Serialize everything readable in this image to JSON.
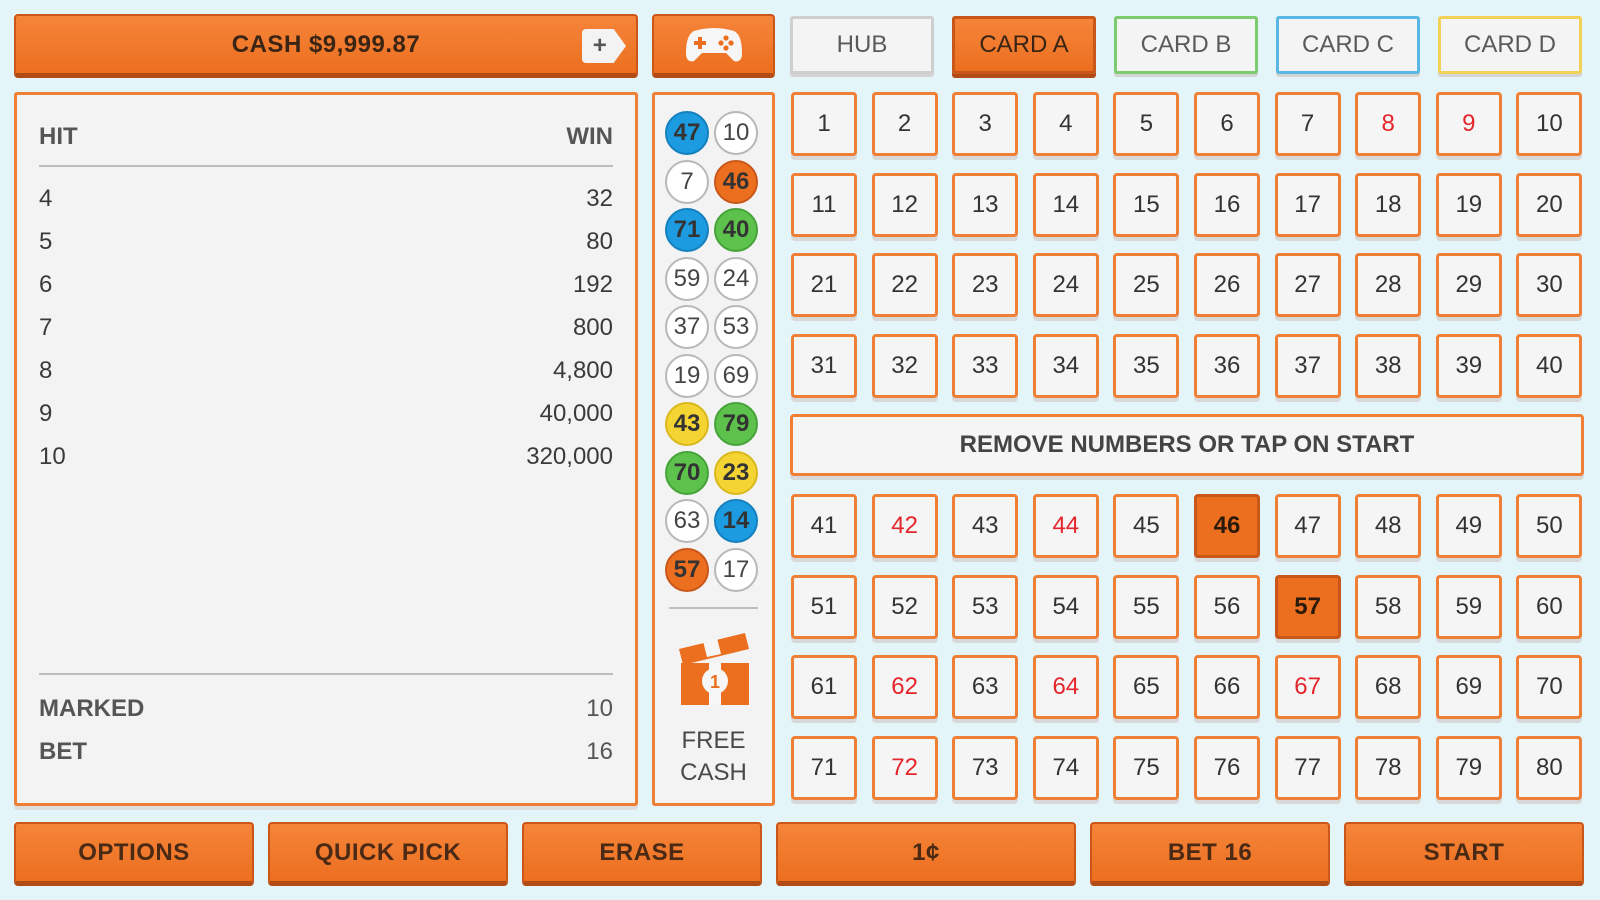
{
  "header": {
    "cash_label": "CASH $9,999.87",
    "add_cash_symbol": "+",
    "gamepad_icon": "gamepad-icon",
    "tabs": [
      {
        "label": "HUB",
        "color": "#cfcfcf"
      },
      {
        "label": "CARD A",
        "color": "#ec6f1f",
        "active": true
      },
      {
        "label": "CARD B",
        "color": "#7ccb6e"
      },
      {
        "label": "CARD C",
        "color": "#59b7e4"
      },
      {
        "label": "CARD D",
        "color": "#f2d256"
      }
    ]
  },
  "paytable": {
    "hit_header": "HIT",
    "win_header": "WIN",
    "rows": [
      {
        "hit": "4",
        "win": "32"
      },
      {
        "hit": "5",
        "win": "80"
      },
      {
        "hit": "6",
        "win": "192"
      },
      {
        "hit": "7",
        "win": "800"
      },
      {
        "hit": "8",
        "win": "4,800"
      },
      {
        "hit": "9",
        "win": "40,000"
      },
      {
        "hit": "10",
        "win": "320,000"
      }
    ],
    "marked_label": "MARKED",
    "marked_value": "10",
    "bet_label": "BET",
    "bet_value": "16"
  },
  "drawn_balls": [
    {
      "number": "47",
      "color": "blue"
    },
    {
      "number": "10",
      "color": "white"
    },
    {
      "number": "7",
      "color": "white"
    },
    {
      "number": "46",
      "color": "orange"
    },
    {
      "number": "71",
      "color": "blue"
    },
    {
      "number": "40",
      "color": "green"
    },
    {
      "number": "59",
      "color": "white"
    },
    {
      "number": "24",
      "color": "white"
    },
    {
      "number": "37",
      "color": "white"
    },
    {
      "number": "53",
      "color": "white"
    },
    {
      "number": "19",
      "color": "white"
    },
    {
      "number": "69",
      "color": "white"
    },
    {
      "number": "43",
      "color": "yellow"
    },
    {
      "number": "79",
      "color": "green"
    },
    {
      "number": "70",
      "color": "green"
    },
    {
      "number": "23",
      "color": "yellow"
    },
    {
      "number": "63",
      "color": "white"
    },
    {
      "number": "14",
      "color": "blue"
    },
    {
      "number": "57",
      "color": "orange"
    },
    {
      "number": "17",
      "color": "white"
    }
  ],
  "free_cash": {
    "label_line1": "FREE",
    "label_line2": "CASH",
    "badge": "1",
    "icon": "gift-box-icon"
  },
  "board": {
    "marked_red": [
      8,
      9,
      42,
      44,
      62,
      64,
      67,
      72
    ],
    "selected": [
      46,
      57
    ],
    "message": "REMOVE NUMBERS OR TAP ON START"
  },
  "controls": {
    "options_label": "OPTIONS",
    "quick_pick_label": "QUICK PICK",
    "erase_label": "ERASE",
    "denomination_label": "1¢",
    "bet_label": "BET 16",
    "start_label": "START"
  },
  "colors": {
    "accent_orange": "#ec6f1f",
    "background": "#e3f5f8",
    "marked_red": "#e4252b"
  }
}
